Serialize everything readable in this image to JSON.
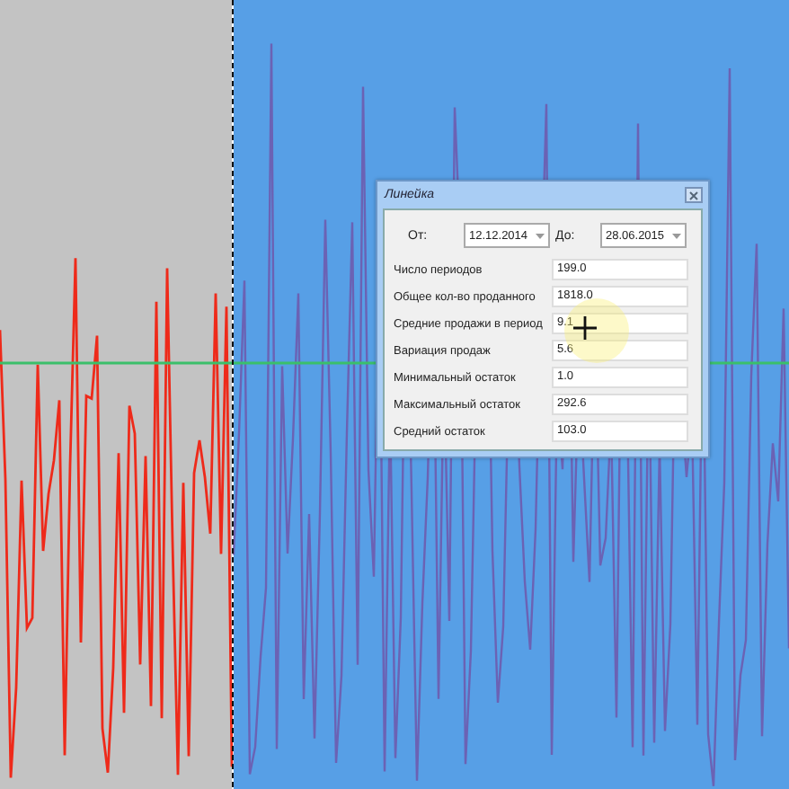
{
  "dialog": {
    "title": "Линейка",
    "from": {
      "label": "От:",
      "value": "12.12.2014"
    },
    "to": {
      "label": "До:",
      "value": "28.06.2015"
    },
    "stats": [
      {
        "label": "Число периодов",
        "value": "199.0"
      },
      {
        "label": "Общее кол-во проданного",
        "value": "1818.0"
      },
      {
        "label": "Средние продажи в период",
        "value": "9.1"
      },
      {
        "label": "Вариация продаж",
        "value": "5.6"
      },
      {
        "label": "Минимальный остаток",
        "value": "1.0"
      },
      {
        "label": "Максимальный остаток",
        "value": "292.6"
      },
      {
        "label": "Средний остаток",
        "value": "103.0"
      }
    ]
  }
}
